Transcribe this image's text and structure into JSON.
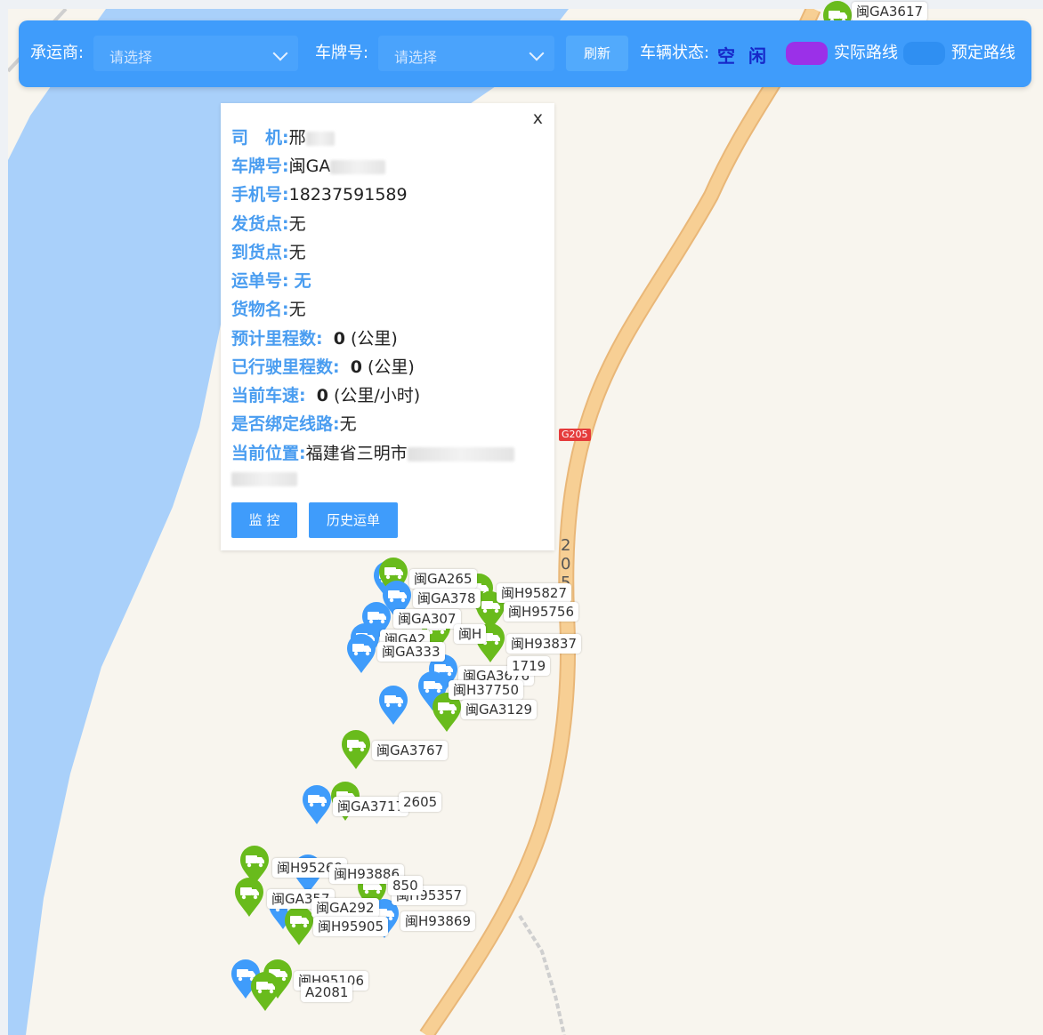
{
  "toolbar": {
    "carrier_label": "承运商:",
    "carrier_placeholder": "请选择",
    "plate_label": "车牌号:",
    "plate_placeholder": "请选择",
    "refresh_label": "刷新",
    "status_label": "车辆状态:",
    "status_value": "空 闲",
    "legend_actual": "实际路线",
    "legend_planned": "预定路线",
    "colors": {
      "bar": "#3f9cfb",
      "actual": "#9b30e8",
      "planned": "#3f9cfb"
    }
  },
  "popup": {
    "close": "x",
    "driver_label": "司　机:",
    "driver_value": "邢",
    "plate_label": "车牌号:",
    "plate_value": "闽GA",
    "phone_label": "手机号:",
    "phone_value": "18237591589",
    "origin_label": "发货点:",
    "origin_value": "无",
    "dest_label": "到货点:",
    "dest_value": "无",
    "waybill_label": "运单号:",
    "waybill_value": "无",
    "goods_label": "货物名:",
    "goods_value": "无",
    "est_label": "预计里程数:",
    "est_value": "0",
    "est_unit": "(公里)",
    "driven_label": "已行驶里程数:",
    "driven_value": "0",
    "driven_unit": "(公里)",
    "speed_label": "当前车速:",
    "speed_value": "0",
    "speed_unit": "(公里/小时)",
    "bound_label": "是否绑定线路:",
    "bound_value": "无",
    "location_label": "当前位置:",
    "location_value": "福建省三明市",
    "monitor_button": "监 控",
    "history_button": "历史运单"
  },
  "map": {
    "road_shield": "G205",
    "road_vertical": [
      "2",
      "0",
      "5"
    ],
    "vehicle_tags": [
      "闽GA3617",
      "闽GA265",
      "闽GA378",
      "闽H95827",
      "闽H95756",
      "闽GA307",
      "闽GA2",
      "闽H",
      "闽H93837",
      "闽GA333",
      "闽GA3676",
      "闽H37750",
      "闽GA3129",
      "闽GA3767",
      "闽GA3717",
      "2605",
      "闽H95269",
      "闽H93886",
      "闽H95357",
      "闽H93869",
      "闽GA357",
      "闽GA292",
      "闽H95905",
      "闽H95106",
      "A2081",
      "1719",
      "850"
    ]
  }
}
